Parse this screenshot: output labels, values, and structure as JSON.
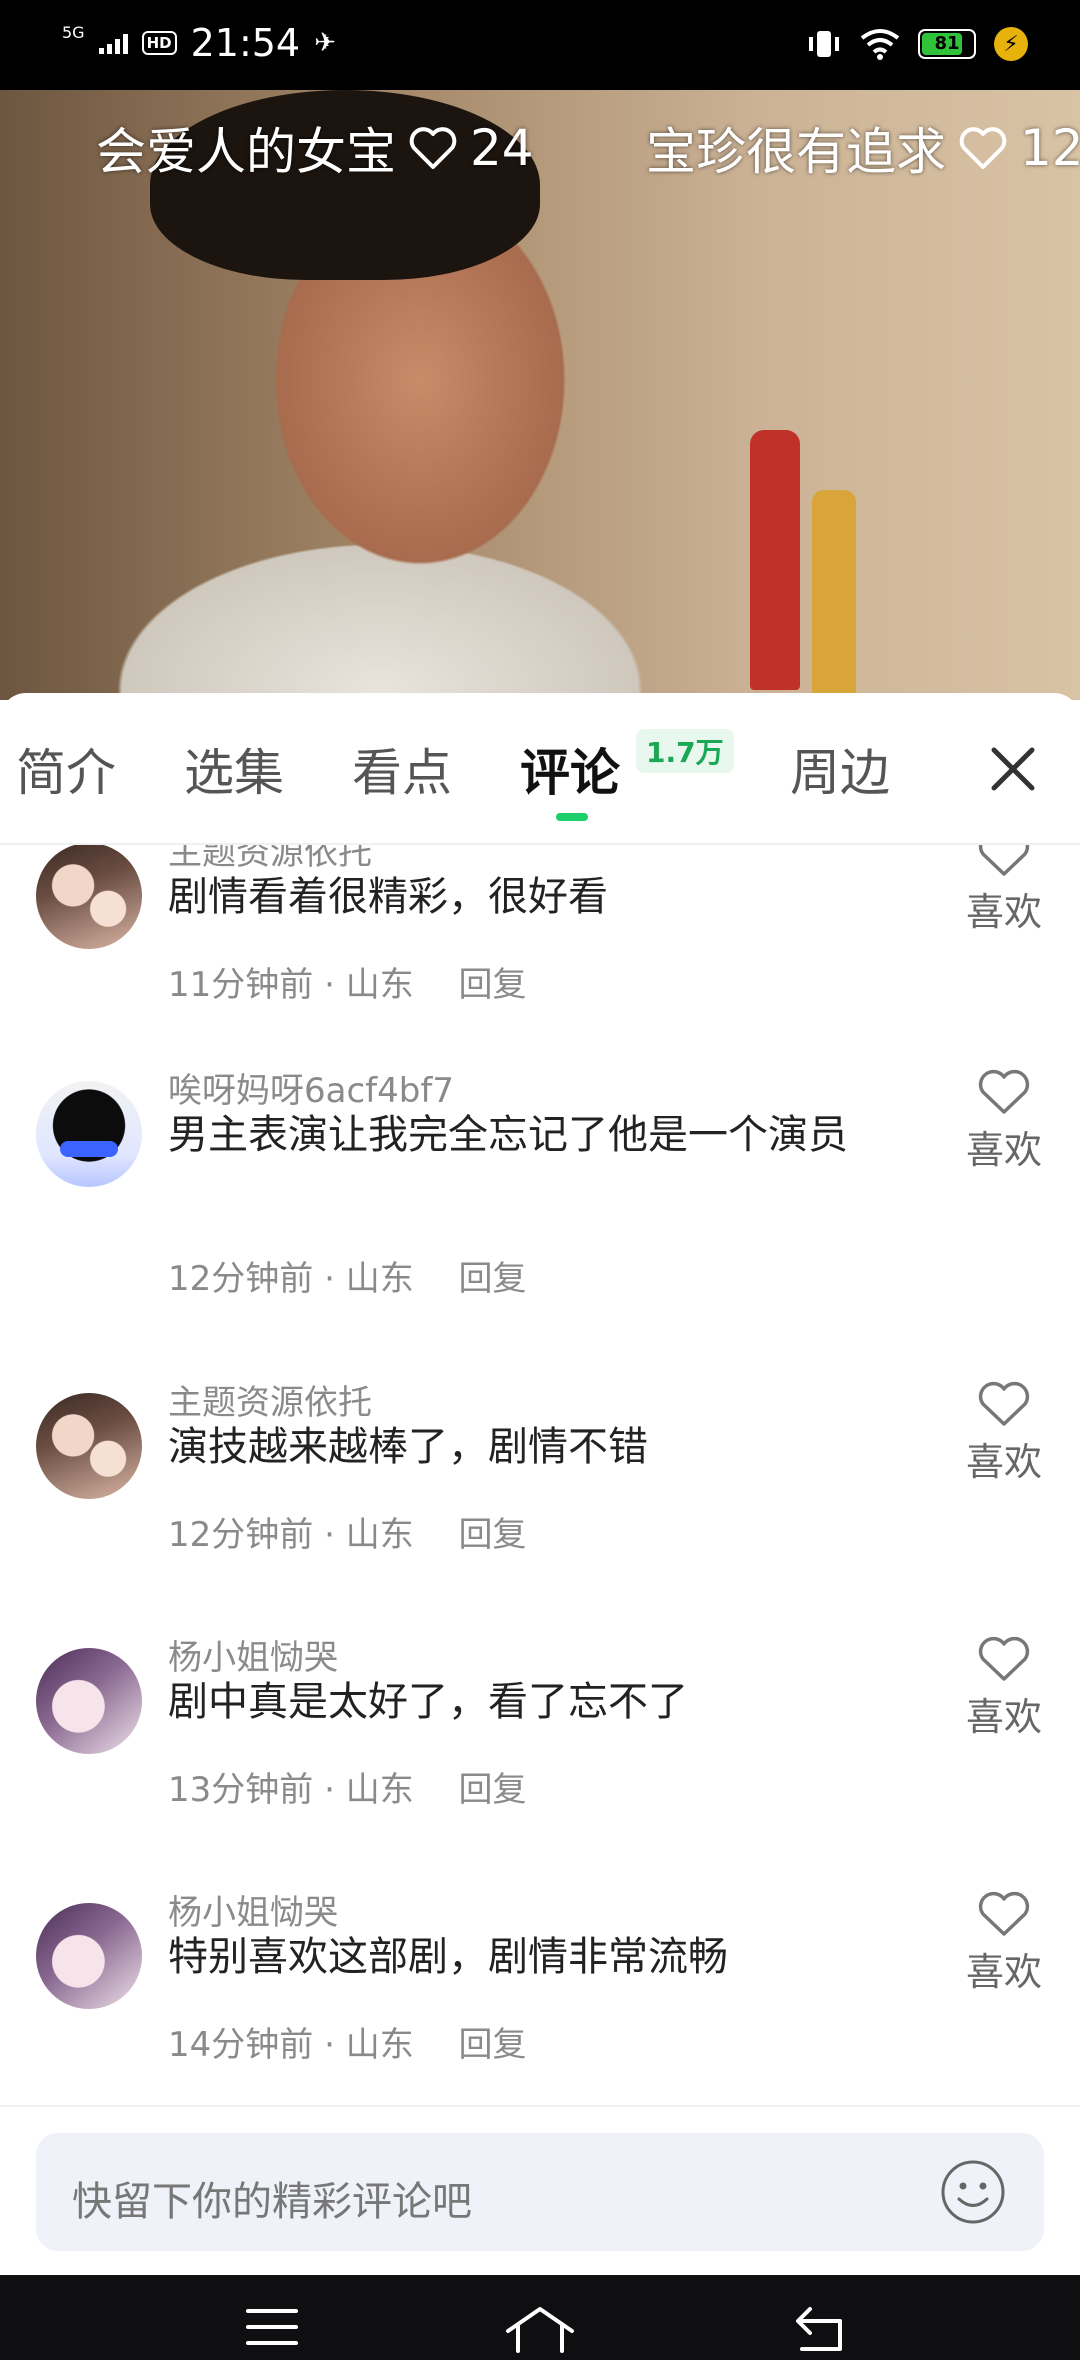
{
  "status_bar": {
    "network": "5G",
    "hd": "HD",
    "time": "21:54",
    "battery": "81",
    "battery_fraction": 0.81
  },
  "video": {
    "danmaku": [
      {
        "text": "会爱人的女宝",
        "likes": "24"
      },
      {
        "text": "宝珍很有追求",
        "likes": "12"
      }
    ]
  },
  "tabs": [
    {
      "label": "简介"
    },
    {
      "label": "选集"
    },
    {
      "label": "看点"
    },
    {
      "label": "评论",
      "badge": "1.7万",
      "active": true
    },
    {
      "label": "周边"
    }
  ],
  "comments": [
    {
      "user": "主题资源依托",
      "text": "剧情看着很精彩，很好看",
      "time": "11分钟前",
      "location": "山东",
      "reply": "回复",
      "like": "喜欢",
      "avatar": "girls"
    },
    {
      "user": "唉呀妈呀6acf4bf7",
      "text": "男主表演让我完全忘记了他是一个演员",
      "time": "12分钟前",
      "location": "山东",
      "reply": "回复",
      "like": "喜欢",
      "avatar": "black"
    },
    {
      "user": "主题资源依托",
      "text": "演技越来越棒了，剧情不错",
      "time": "12分钟前",
      "location": "山东",
      "reply": "回复",
      "like": "喜欢",
      "avatar": "girls"
    },
    {
      "user": "杨小姐恸哭",
      "text": "剧中真是太好了，看了忘不了",
      "time": "13分钟前",
      "location": "山东",
      "reply": "回复",
      "like": "喜欢",
      "avatar": "woman"
    },
    {
      "user": "杨小姐恸哭",
      "text": "特别喜欢这部剧，剧情非常流畅",
      "time": "14分钟前",
      "location": "山东",
      "reply": "回复",
      "like": "喜欢",
      "avatar": "woman"
    }
  ],
  "input": {
    "placeholder": "快留下你的精彩评论吧"
  },
  "icons": {
    "heart": "heart-icon",
    "close": "close-icon",
    "emoji": "smiley-icon",
    "nav": [
      "menu-icon",
      "home-icon",
      "back-icon"
    ]
  },
  "colors": {
    "accent": "#1ccf6a",
    "badge_text": "#1aa855",
    "battery": "#30c238"
  }
}
